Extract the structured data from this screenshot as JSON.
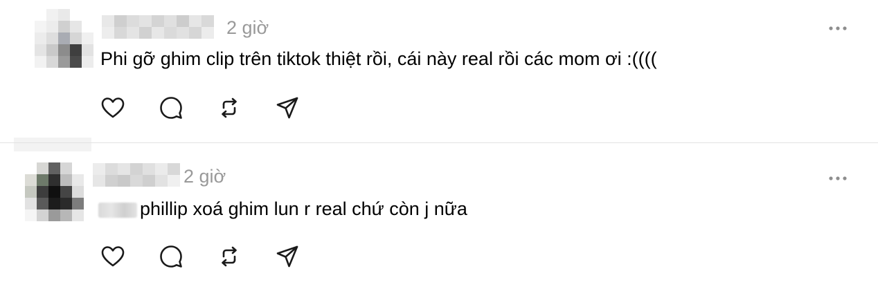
{
  "comments": [
    {
      "time": "2 giờ",
      "text": "Phi gỡ ghim clip trên tiktok thiệt rồi, cái này real rồi các mom ơi :((((",
      "more_icon": "ellipsis-icon",
      "actions": [
        "heart-icon",
        "comment-icon",
        "repost-icon",
        "share-icon"
      ]
    },
    {
      "time": "2 giờ",
      "text": "phillip xoá ghim lun r real chứ còn j nữa",
      "more_icon": "ellipsis-icon",
      "actions": [
        "heart-icon",
        "comment-icon",
        "repost-icon",
        "share-icon"
      ]
    }
  ],
  "colors": {
    "text": "#000000",
    "muted": "#999999",
    "icon": "#1a1a1a",
    "divider": "#e2e2e2"
  }
}
